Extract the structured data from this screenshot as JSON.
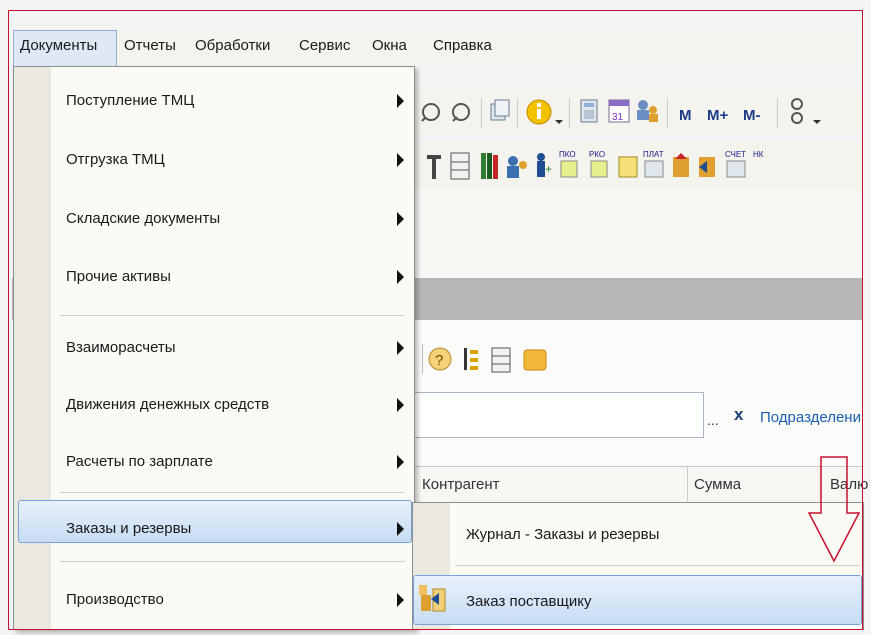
{
  "menubar": {
    "items": [
      "Документы",
      "Отчеты",
      "Обработки",
      "Сервис",
      "Окна",
      "Справка"
    ]
  },
  "dropdown": {
    "items": [
      {
        "label": "Поступление ТМЦ"
      },
      {
        "label": "Отгрузка ТМЦ"
      },
      {
        "label": "Складские документы"
      },
      {
        "label": "Прочие активы"
      },
      {
        "label": "Взаиморасчеты"
      },
      {
        "label": "Движения денежных средств"
      },
      {
        "label": "Расчеты по зарплате"
      },
      {
        "label": "Заказы и резервы"
      },
      {
        "label": "Производство"
      }
    ]
  },
  "submenu": {
    "items": [
      {
        "label": "Журнал - Заказы и резервы"
      },
      {
        "label": "Заказ поставщику"
      }
    ]
  },
  "toolbar": {
    "buttons": [
      "M",
      "M+",
      "M-"
    ],
    "small_labels": [
      "ПКО",
      "РКО",
      "ПЛАТ",
      "СЧЕТ",
      "НК"
    ],
    "calendar_day": "31"
  },
  "filter": {
    "ellipsis": "...",
    "clear": "x",
    "link": "Подразделени"
  },
  "table": {
    "columns": [
      "Контрагент",
      "Сумма",
      "Валю"
    ]
  },
  "colors": {
    "frame": "#c8102e",
    "highlight": "#c7dcf3",
    "arrow_outline": "#c8102e"
  }
}
